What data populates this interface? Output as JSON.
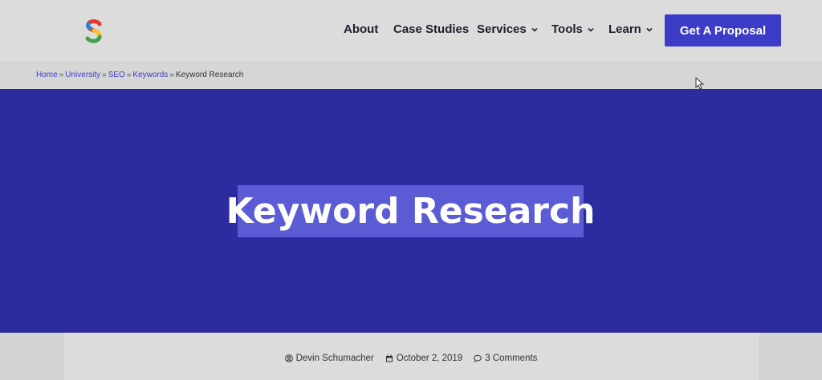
{
  "header": {
    "logo_letter": "S",
    "nav": [
      {
        "label": "About"
      },
      {
        "label": "Case Studies"
      },
      {
        "label": "Services"
      },
      {
        "label": "Tools"
      },
      {
        "label": "Learn"
      }
    ],
    "cta_label": "Get A Proposal"
  },
  "breadcrumb": {
    "items": [
      "Home",
      "University",
      "SEO",
      "Keywords"
    ],
    "separator": "»",
    "current": "Keyword Research"
  },
  "hero": {
    "title": "Keyword Research"
  },
  "meta": {
    "author": "Devin Schumacher",
    "date": "October 2, 2019",
    "comments": "3 Comments"
  },
  "colors": {
    "brand": "#3d3cc9",
    "hero_bg": "#2d2ba0",
    "title_highlight": "#5b5bd6"
  }
}
